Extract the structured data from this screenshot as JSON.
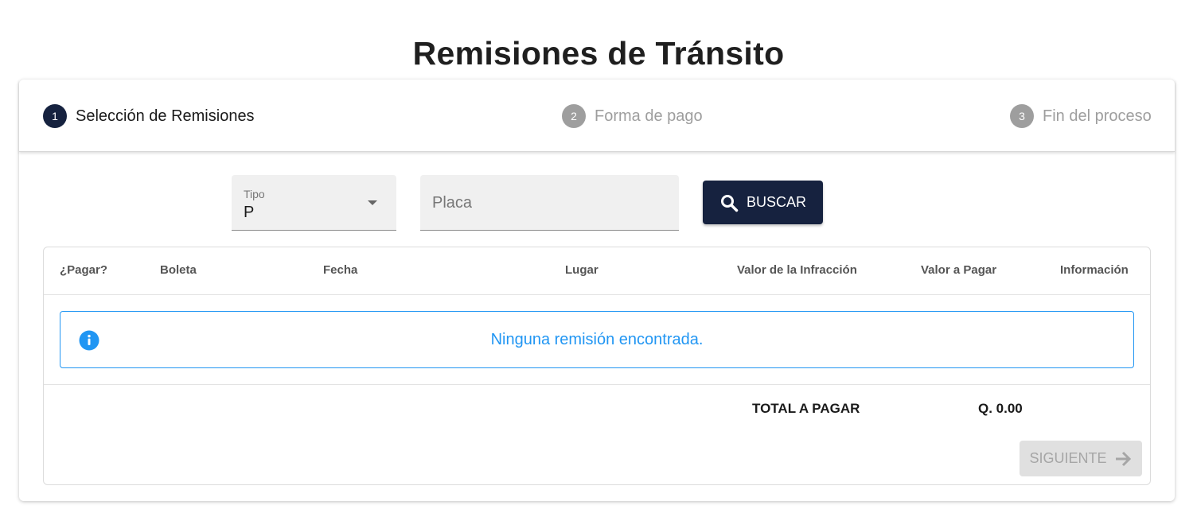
{
  "page": {
    "title": "Remisiones de Tránsito"
  },
  "stepper": {
    "steps": [
      {
        "number": "1",
        "label": "Selección de Remisiones",
        "active": true
      },
      {
        "number": "2",
        "label": "Forma de pago",
        "active": false
      },
      {
        "number": "3",
        "label": "Fin del proceso",
        "active": false
      }
    ]
  },
  "search": {
    "tipo_label": "Tipo",
    "tipo_value": "P",
    "placa_placeholder": "Placa",
    "button_label": "BUSCAR",
    "button_icon": "search-icon"
  },
  "table": {
    "headers": [
      "¿Pagar?",
      "Boleta",
      "Fecha",
      "Lugar",
      "Valor de la Infracción",
      "Valor a Pagar",
      "Información"
    ],
    "empty_message": "Ninguna remisión encontrada.",
    "empty_icon": "info-icon"
  },
  "totals": {
    "label": "TOTAL A PAGAR",
    "value": "Q. 0.00"
  },
  "footer": {
    "next_label": "SIGUIENTE",
    "next_icon": "arrow-right-icon",
    "next_disabled": true
  },
  "colors": {
    "primary": "#16223f",
    "info": "#2196f3",
    "inactive_step": "#9e9e9e",
    "disabled_button": "#e0e0e0"
  }
}
